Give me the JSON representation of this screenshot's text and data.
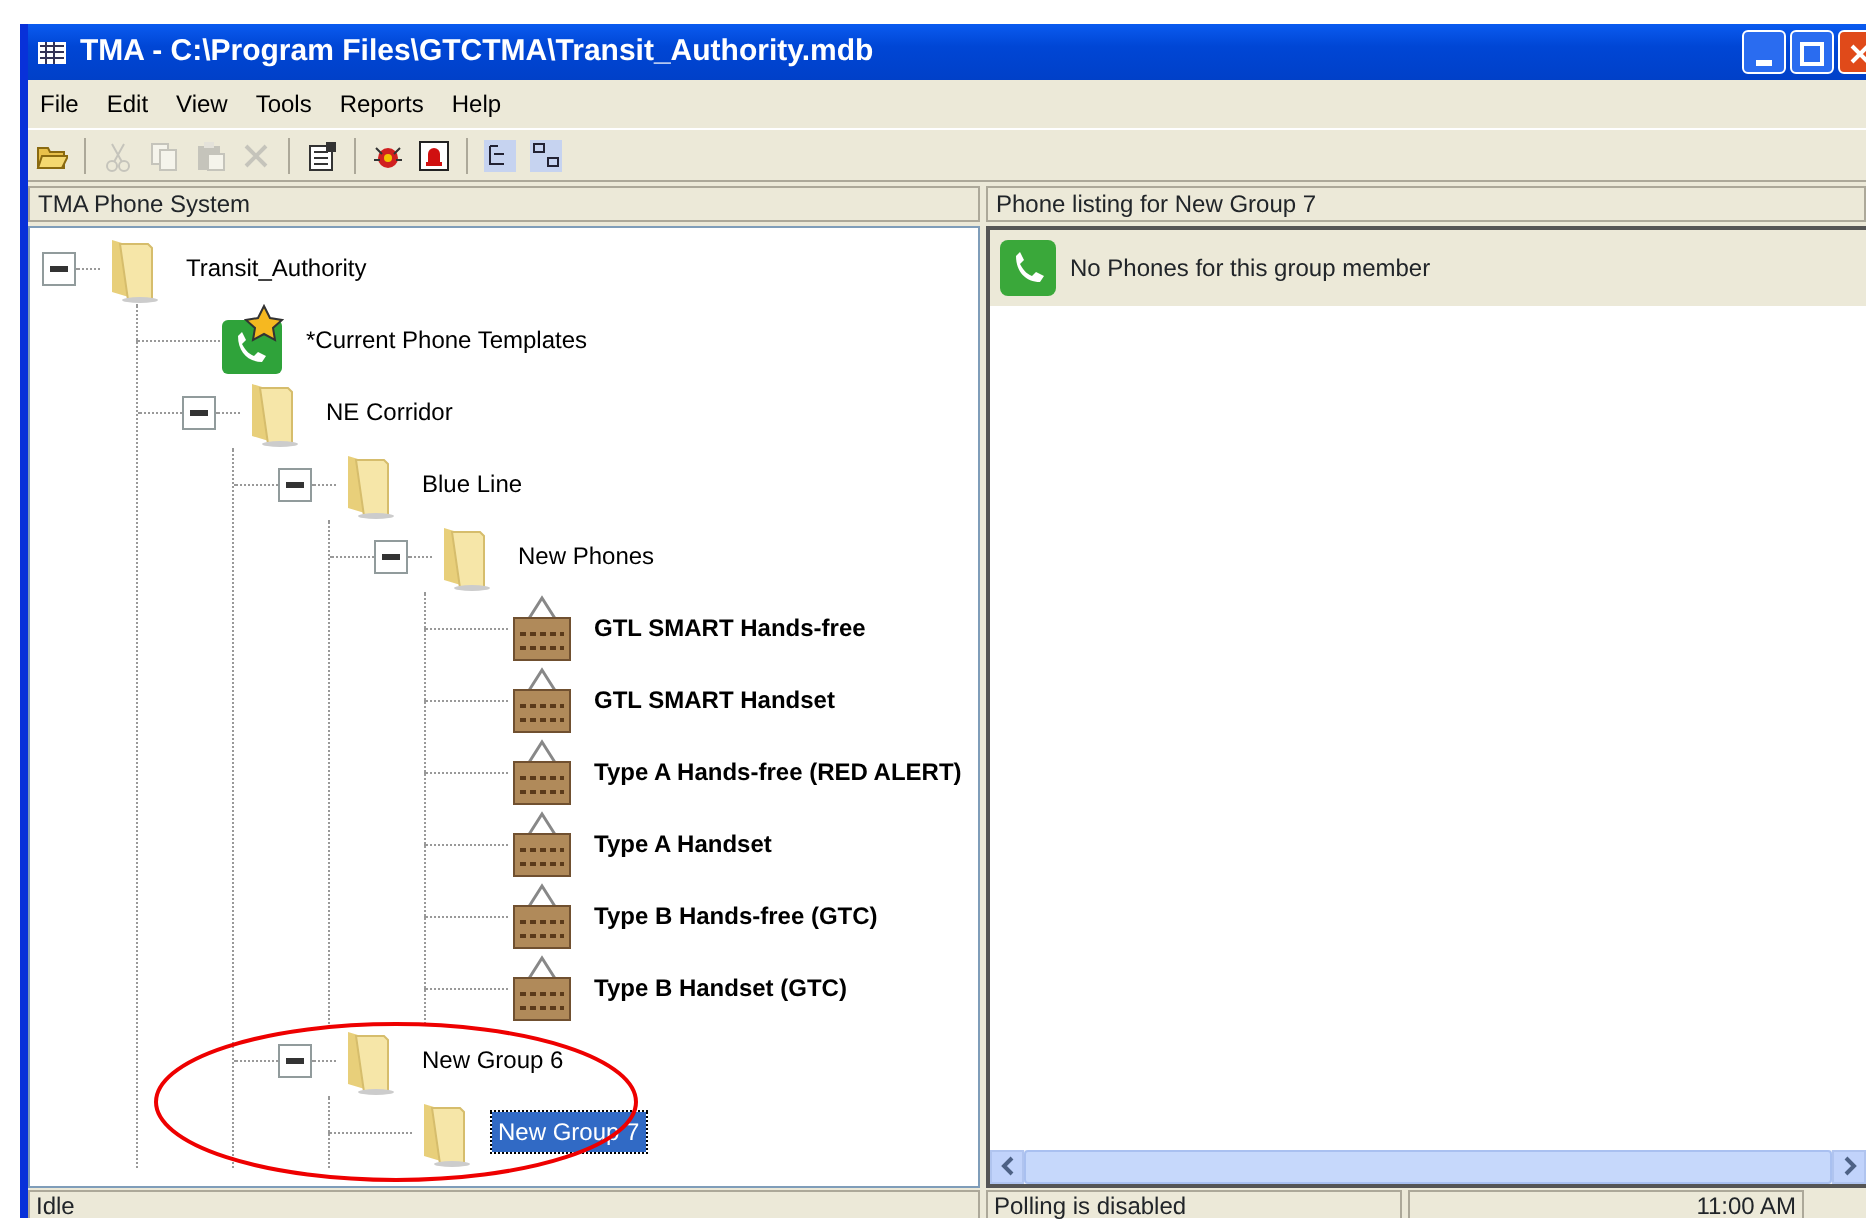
{
  "window": {
    "title": "TMA - C:\\Program Files\\GTCTMA\\Transit_Authority.mdb"
  },
  "menu": [
    "File",
    "Edit",
    "View",
    "Tools",
    "Reports",
    "Help"
  ],
  "toolbar": [
    {
      "kind": "open",
      "disabled": false
    },
    {
      "kind": "sep"
    },
    {
      "kind": "cut",
      "disabled": true
    },
    {
      "kind": "copy",
      "disabled": true
    },
    {
      "kind": "paste",
      "disabled": true
    },
    {
      "kind": "delete",
      "disabled": true
    },
    {
      "kind": "sep"
    },
    {
      "kind": "properties",
      "disabled": false
    },
    {
      "kind": "sep"
    },
    {
      "kind": "bug",
      "disabled": false
    },
    {
      "kind": "alarm",
      "disabled": false
    },
    {
      "kind": "sep"
    },
    {
      "kind": "tree",
      "disabled": false
    },
    {
      "kind": "list",
      "disabled": false
    }
  ],
  "left_pane": {
    "title": "TMA Phone System",
    "tree": [
      {
        "label": "Transit_Authority",
        "kind": "folder",
        "expanded": true,
        "selected": false,
        "children": [
          {
            "label": "*Current Phone Templates",
            "kind": "template",
            "selected": false
          },
          {
            "label": "NE Corridor",
            "kind": "folder",
            "expanded": true,
            "selected": false,
            "children": [
              {
                "label": "Blue Line",
                "kind": "folder",
                "expanded": true,
                "selected": false,
                "children": [
                  {
                    "label": "New Phones",
                    "kind": "folder",
                    "expanded": true,
                    "selected": false,
                    "children": [
                      {
                        "label": "GTL SMART Hands-free",
                        "kind": "phone",
                        "selected": false
                      },
                      {
                        "label": "GTL SMART Handset",
                        "kind": "phone",
                        "selected": false
                      },
                      {
                        "label": "Type A Hands-free (RED ALERT)",
                        "kind": "phone",
                        "selected": false
                      },
                      {
                        "label": "Type A Handset",
                        "kind": "phone",
                        "selected": false
                      },
                      {
                        "label": "Type B Hands-free (GTC)",
                        "kind": "phone",
                        "selected": false
                      },
                      {
                        "label": "Type B Handset (GTC)",
                        "kind": "phone",
                        "selected": false
                      }
                    ]
                  }
                ]
              },
              {
                "label": "New Group 6",
                "kind": "folder",
                "expanded": true,
                "selected": false,
                "children": [
                  {
                    "label": "New Group 7",
                    "kind": "folder",
                    "selected": true
                  }
                ]
              }
            ]
          }
        ]
      }
    ]
  },
  "right_pane": {
    "title": "Phone listing for New Group 7",
    "message": "No Phones for this group member"
  },
  "status_bar": [
    "Idle",
    "Polling is disabled",
    "11:00 AM"
  ]
}
